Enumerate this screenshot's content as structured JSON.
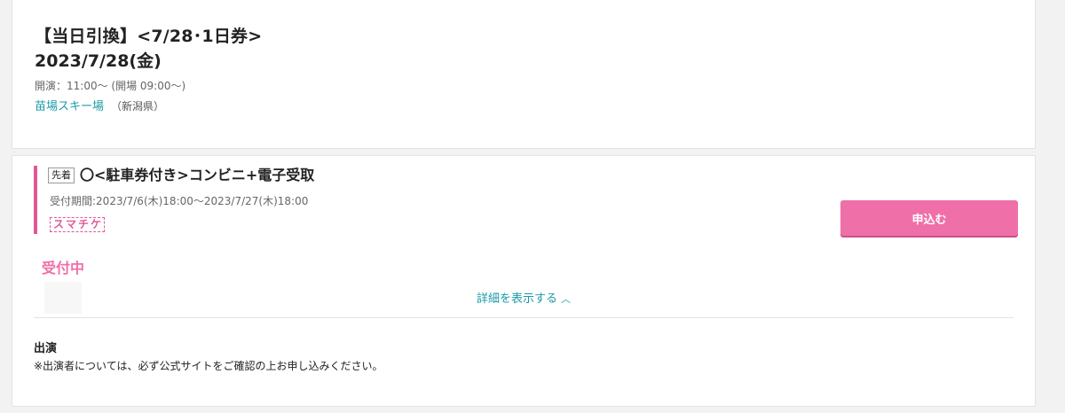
{
  "event": {
    "title": "【当日引換】<7/28･1日券>",
    "date": "2023/7/28(金)",
    "time": "開演：11:00〜 (開場 09:00〜)",
    "venue": "苗場スキー場",
    "prefecture": "（新潟県）"
  },
  "ticket": {
    "tag": "先着",
    "name": "〇<駐車券付き>コンビニ+電子受取",
    "period": "受付期間:2023/7/6(木)18:00〜2023/7/27(木)18:00",
    "badge_chars": [
      "ス",
      "マ",
      "チ",
      "ケ"
    ],
    "apply_label": "申込む",
    "status": "受付中",
    "details_label": "詳細を表示する",
    "details_icon": "chevron-up-icon"
  },
  "cast": {
    "heading": "出演",
    "note": "※出演者については、必ず公式サイトをご確認の上お申し込みください。"
  },
  "colors": {
    "accent_pink": "#e1579a",
    "button_pink": "#ef6fa9",
    "link_teal": "#1a9aa8"
  }
}
